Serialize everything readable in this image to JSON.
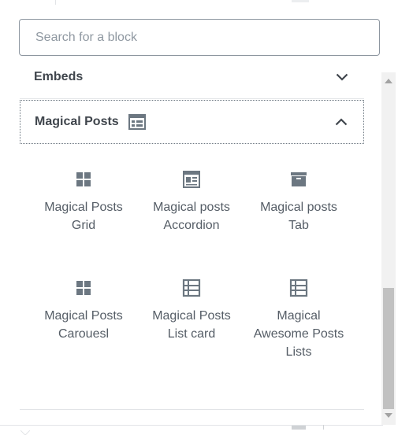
{
  "search": {
    "placeholder": "Search for a block"
  },
  "sections": {
    "embeds": {
      "title": "Embeds",
      "expanded": false
    },
    "magical_posts": {
      "title": "Magical Posts",
      "expanded": true
    }
  },
  "blocks": [
    {
      "icon": "grid-icon",
      "label_line1": "Magical Posts",
      "label_line2": "Grid"
    },
    {
      "icon": "accordion-icon",
      "label_line1": "Magical posts",
      "label_line2": "Accordion"
    },
    {
      "icon": "archive-tab-icon",
      "label_line1": "Magical posts",
      "label_line2": "Tab"
    },
    {
      "icon": "grid-icon",
      "label_line1": "Magical Posts",
      "label_line2": "Carouesl"
    },
    {
      "icon": "list-card-icon",
      "label_line1": "Magical Posts",
      "label_line2": "List card"
    },
    {
      "icon": "list-card-icon",
      "label_line1": "Magical",
      "label_line2": "Awesome Posts",
      "label_line3": "Lists"
    }
  ],
  "colors": {
    "icon": "#6c7781",
    "text": "#555d66",
    "heading": "#40464d",
    "border": "#8d96a0"
  }
}
